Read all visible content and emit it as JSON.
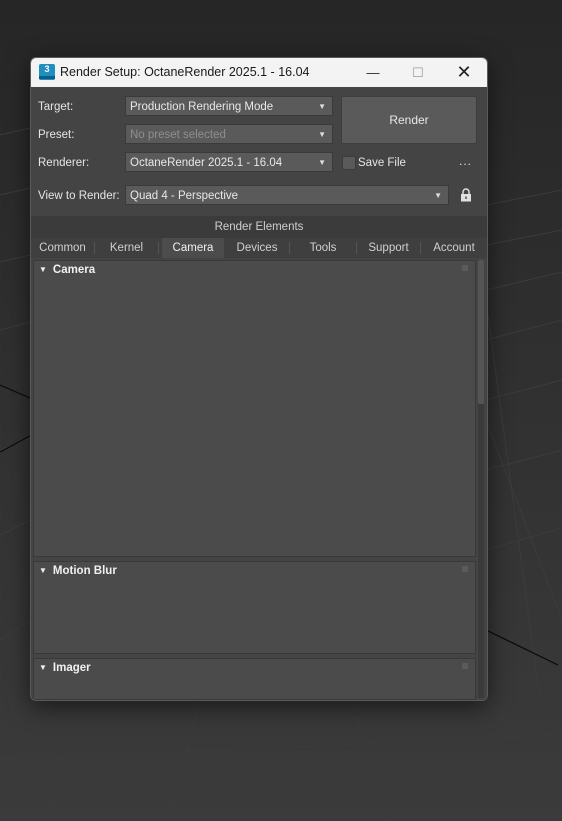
{
  "window": {
    "title": "Render Setup: OctaneRender 2025.1 - 16.04",
    "app_icon_text": "3",
    "minimize": "—",
    "maximize": "☐",
    "close": "✕"
  },
  "form": {
    "target_label": "Target:",
    "target_value": "Production Rendering Mode",
    "preset_label": "Preset:",
    "preset_value": "No preset selected",
    "renderer_label": "Renderer:",
    "renderer_value": "OctaneRender 2025.1 - 16.04",
    "view_label": "View to Render:",
    "view_value": "Quad 4 - Perspective",
    "render_button": "Render",
    "save_file_label": "Save File",
    "more_button": "...",
    "dropdown_arrow": "▼"
  },
  "render_elements_label": "Render Elements",
  "tabs": [
    {
      "label": "Common"
    },
    {
      "label": "Kernel"
    },
    {
      "label": "Camera"
    },
    {
      "label": "Devices"
    },
    {
      "label": "Tools"
    },
    {
      "label": "Support"
    },
    {
      "label": "Account"
    }
  ],
  "active_tab": "Camera",
  "rollouts": [
    {
      "title": "Camera",
      "expanded": true
    },
    {
      "title": "Motion Blur",
      "expanded": true
    },
    {
      "title": "Imager",
      "expanded": true
    }
  ],
  "rollout_toggle_glyph": "▼",
  "colors": {
    "window_bg": "#444444",
    "titlebar_bg": "#f3f3f3",
    "app_icon": "#1f8fbf"
  }
}
